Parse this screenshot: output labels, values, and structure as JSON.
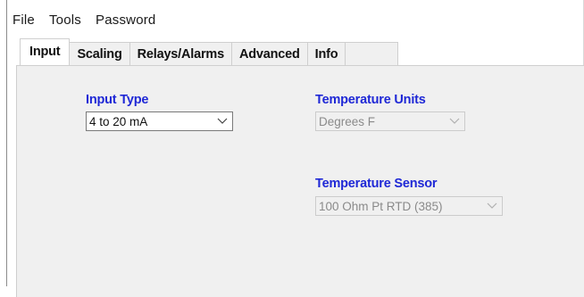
{
  "menu": {
    "items": [
      {
        "label": "File"
      },
      {
        "label": "Tools"
      },
      {
        "label": "Password"
      }
    ]
  },
  "tabs": [
    {
      "label": "Input",
      "active": true
    },
    {
      "label": "Scaling",
      "active": false
    },
    {
      "label": "Relays/Alarms",
      "active": false
    },
    {
      "label": "Advanced",
      "active": false
    },
    {
      "label": "Info",
      "active": false
    }
  ],
  "input_panel": {
    "input_type": {
      "label": "Input Type",
      "value": "4 to 20 mA",
      "enabled": true
    },
    "temperature_units": {
      "label": "Temperature Units",
      "value": "Degrees F",
      "enabled": false
    },
    "temperature_sensor": {
      "label": "Temperature Sensor",
      "value": "100 Ohm Pt RTD (385)",
      "enabled": false
    }
  },
  "colors": {
    "label_blue": "#1f28d6",
    "panel_bg": "#f0f0f0",
    "disabled_text": "#8a8a8a"
  },
  "icons": {
    "combo_arrow": "chevron-down-icon"
  }
}
